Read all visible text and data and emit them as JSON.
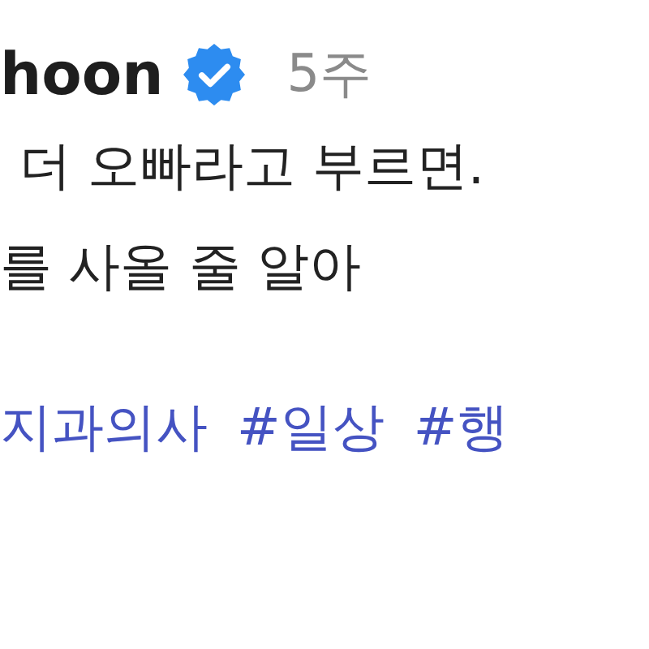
{
  "comment": {
    "username": "hoon",
    "verified": true,
    "time": "5주",
    "lines": [
      "더 오빠라고 부르면.",
      "를 사올 줄 알아"
    ],
    "hashtags": [
      "지과의사",
      "#일상",
      "#행"
    ]
  }
}
